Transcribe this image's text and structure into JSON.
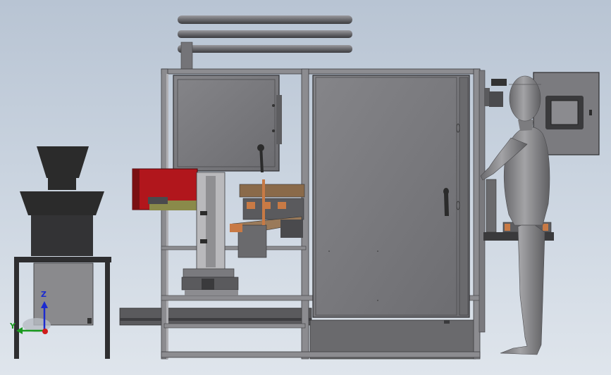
{
  "viewport": {
    "background_top": "#b8c4d3",
    "background_bottom": "#dfe5ec"
  },
  "triad": {
    "z_label": "Z",
    "y_label": "Y",
    "z_color": "#1b2bd0",
    "y_color": "#1a9a20",
    "x_color": "#d01b1b"
  },
  "colors": {
    "frame": "#6f6f73",
    "panel": "#7b7b7f",
    "dark": "#3a3a3c",
    "black_part": "#2b2b2b",
    "red_motor": "#b1161c",
    "mannequin": "#8e8e90",
    "screen": "#59595b",
    "copper": "#c87a45"
  },
  "components": [
    "hopper-feeder",
    "exhaust-pipes",
    "electrical-cabinet-top",
    "main-frame",
    "right-cabinet-door",
    "control-panel-box",
    "operator-mannequin",
    "red-motor",
    "welding-fixture"
  ]
}
